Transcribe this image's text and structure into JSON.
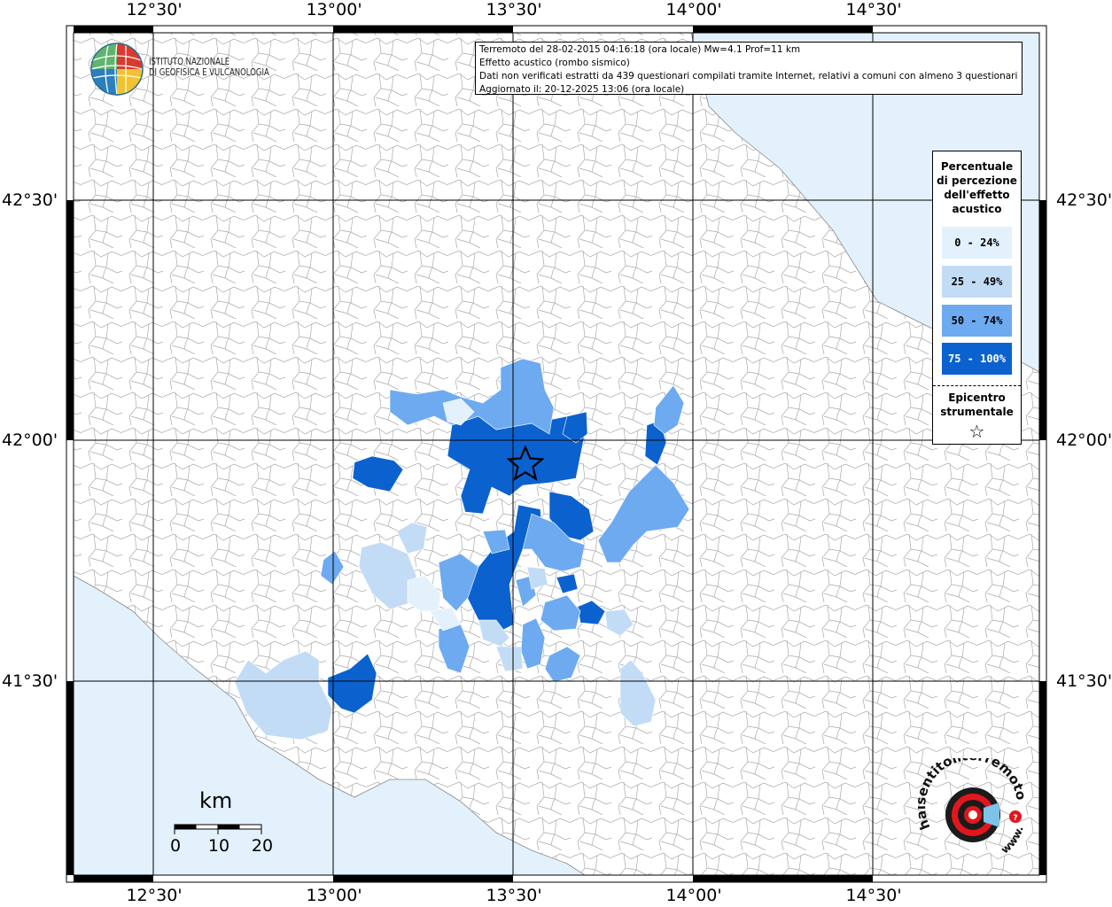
{
  "map": {
    "info": {
      "line1": "Terremoto del 28-02-2015 04:16:18 (ora locale) Mw=4.1 Prof=11 km",
      "line2": "Effetto acustico (rombo sismico)",
      "line3": "Dati non verificati estratti da 439 questionari compilati tramite Internet, relativi a comuni con almeno 3 questionari.",
      "line4": "Aggiornato il: 20-12-2025 13:06 (ora locale)"
    },
    "institute_logo": {
      "line1": "ISTITUTO NAZIONALE",
      "line2": "DI GEOFISICA E VULCANOLOGIA"
    },
    "axes": {
      "longitude_ticks": [
        "12°30'",
        "13°00'",
        "13°30'",
        "14°00'",
        "14°30'"
      ],
      "latitude_ticks": [
        "42°30'",
        "42°00'",
        "41°30'"
      ]
    },
    "legend": {
      "title": "Percentuale di percezione dell'effetto acustico",
      "title_lines": [
        "Percentuale",
        "di percezione",
        "dell'effetto",
        "acustico"
      ],
      "classes": [
        {
          "label": "0 - 24%",
          "color": "#e3f1fc"
        },
        {
          "label": "25 - 49%",
          "color": "#c3dcf6"
        },
        {
          "label": "50 - 74%",
          "color": "#6eaaf0"
        },
        {
          "label": "75 - 100%",
          "color": "#0b62cf"
        }
      ],
      "epicenter_label": "Epicentro strumentale",
      "epicenter_lines": [
        "Epicentro",
        "strumentale"
      ],
      "epicenter_symbol": "☆"
    },
    "scale_bar": {
      "unit": "km",
      "labels": [
        "0",
        "10",
        "20"
      ]
    },
    "brand_logo": {
      "text_main": "haisentitoilterremoto.it",
      "text_www": "www."
    },
    "colors": {
      "sea": "#e3f1fc",
      "boundary": "#a9a9a9",
      "grid": "#000000"
    }
  }
}
